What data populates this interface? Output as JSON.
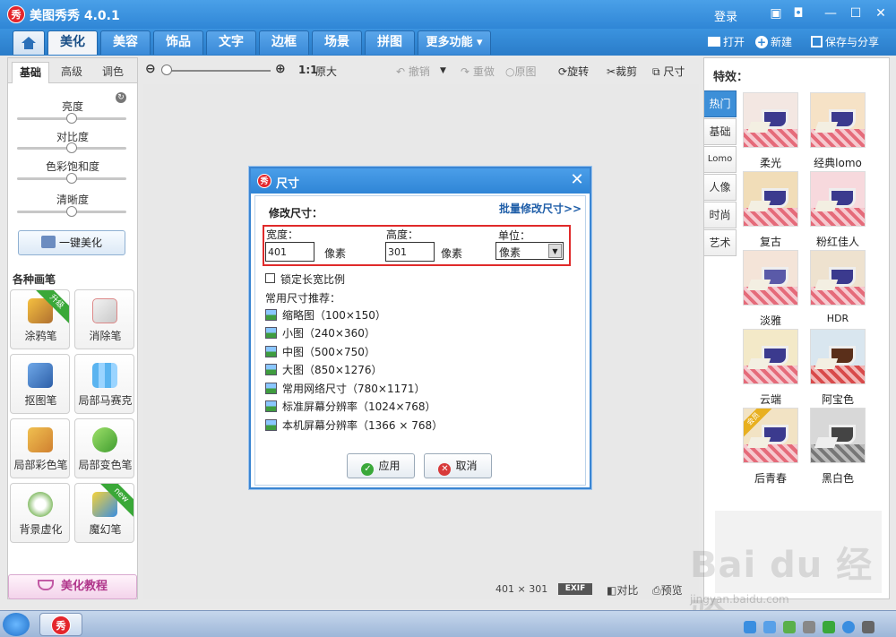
{
  "window": {
    "app_logo_text": "秀",
    "title": "美图秀秀 4.0.1",
    "login": "登录",
    "minimize": "—",
    "maximize": "☐",
    "close": "✕"
  },
  "nav": {
    "tabs": [
      "美化",
      "美容",
      "饰品",
      "文字",
      "边框",
      "场景",
      "拼图",
      "更多功能 ▾"
    ],
    "active_tab": "美化",
    "open": "打开",
    "new": "新建",
    "save_share": "保存与分享"
  },
  "left": {
    "subtabs": [
      "基础",
      "高级",
      "调色"
    ],
    "adjust": [
      {
        "label": "亮度",
        "level": 0.5
      },
      {
        "label": "对比度",
        "level": 0.5
      },
      {
        "label": "色彩饱和度",
        "level": 0.5
      },
      {
        "label": "清晰度",
        "level": 0.5
      }
    ],
    "one_click": "一键美化",
    "brushes_title": "各种画笔",
    "brushes": [
      {
        "label": "涂鸦笔",
        "badge": "升级"
      },
      {
        "label": "消除笔",
        "badge": ""
      },
      {
        "label": "抠图笔",
        "badge": ""
      },
      {
        "label": "局部马赛克",
        "badge": ""
      },
      {
        "label": "局部彩色笔",
        "badge": ""
      },
      {
        "label": "局部变色笔",
        "badge": ""
      },
      {
        "label": "背景虚化",
        "badge": ""
      },
      {
        "label": "魔幻笔",
        "badge": "new"
      }
    ],
    "tutorial": "美化教程"
  },
  "toolbar": {
    "zoom_ratio": "1:1",
    "original_size": "原大",
    "undo": "撤销",
    "redo": "重做",
    "original": "原图",
    "rotate": "旋转",
    "crop": "裁剪",
    "size": "尺寸",
    "zoom_level": 0.0
  },
  "status": {
    "dimensions": "401 × 301",
    "exif": "EXIF",
    "compare": "对比",
    "preview": "预览"
  },
  "effects": {
    "title": "特效：",
    "categories": [
      "热门",
      "基础",
      "Lomo",
      "人像",
      "时尚",
      "艺术"
    ],
    "active_category": "热门",
    "items": [
      {
        "label": "柔光",
        "badge": ""
      },
      {
        "label": "经典lomo",
        "badge": ""
      },
      {
        "label": "复古",
        "badge": ""
      },
      {
        "label": "粉红佳人",
        "badge": ""
      },
      {
        "label": "淡雅",
        "badge": ""
      },
      {
        "label": "HDR",
        "badge": ""
      },
      {
        "label": "云端",
        "badge": ""
      },
      {
        "label": "阿宝色",
        "badge": ""
      },
      {
        "label": "后青春",
        "badge": "会员"
      },
      {
        "label": "黑白色",
        "badge": ""
      }
    ]
  },
  "dialog": {
    "logo_text": "秀",
    "title": "尺寸",
    "close": "✕",
    "section": "修改尺寸：",
    "batch_link": "批量修改尺寸>>",
    "width_label": "宽度：",
    "width_value": "401",
    "width_unit": "像素",
    "height_label": "高度：",
    "height_value": "301",
    "height_unit": "像素",
    "unit_label": "单位：",
    "unit_value": "像素",
    "lock_ratio": "锁定长宽比例",
    "presets_title": "常用尺寸推荐：",
    "presets": [
      "缩略图（100×150）",
      "小图（240×360）",
      "中图（500×750）",
      "大图（850×1276）",
      "常用网络尺寸（780×1171）",
      "标准屏幕分辨率（1024×768）",
      "本机屏幕分辨率（1366 × 768）"
    ],
    "apply": "应用",
    "cancel": "取消"
  },
  "watermark": {
    "text": "Bai du 经验",
    "url": "jingyan.baidu.com"
  },
  "colors": {
    "accent": "#2f86d6",
    "highlight": "#e02a2a"
  }
}
